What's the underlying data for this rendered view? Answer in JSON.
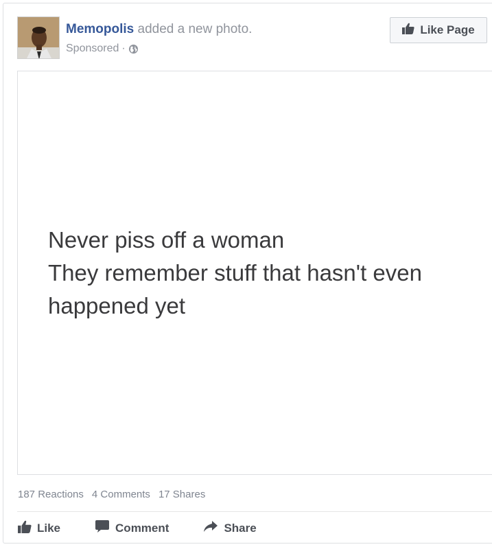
{
  "post": {
    "page_name": "Memopolis",
    "action_text": " added a new photo.",
    "sponsored": "Sponsored",
    "separator": "·",
    "like_page_label": "Like Page"
  },
  "photo": {
    "lines": [
      "Never piss off a woman",
      "They remember stuff that hasn't even",
      "happened yet"
    ]
  },
  "stats": {
    "reactions": "187 Reactions",
    "comments": "4 Comments",
    "shares": "17 Shares"
  },
  "actions": {
    "like": "Like",
    "comment": "Comment",
    "share": "Share"
  },
  "colors": {
    "link": "#365899",
    "muted": "#90949c",
    "action_text": "#4b4f56",
    "border": "#dddfe2"
  },
  "icons": {
    "avatar": "page-avatar",
    "globe": "globe-icon",
    "thumb": "thumbs-up-icon",
    "comment": "comment-bubble-icon",
    "share": "share-arrow-icon"
  }
}
